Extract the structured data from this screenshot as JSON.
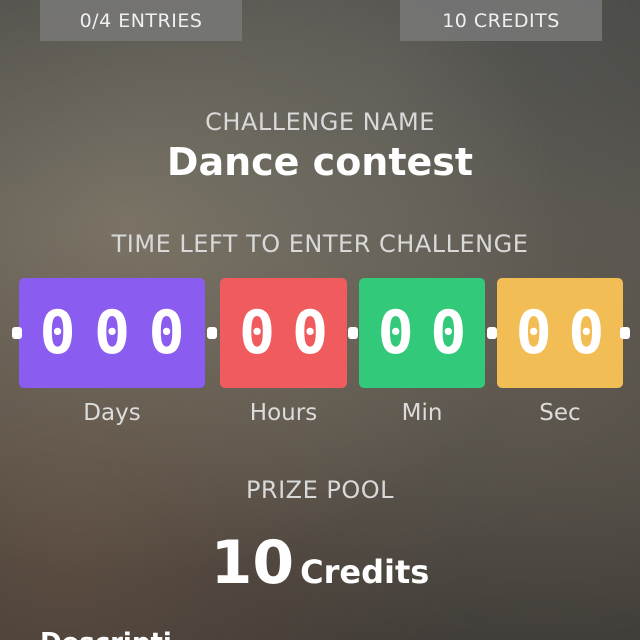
{
  "header": {
    "entries_label": "0/4 ENTRIES",
    "credits_label": "10 CREDITS"
  },
  "challenge": {
    "label": "CHALLENGE NAME",
    "name": "Dance contest"
  },
  "timer": {
    "label": "TIME LEFT TO ENTER CHALLENGE",
    "units": [
      {
        "label": "Days",
        "digits": [
          "0",
          "0",
          "0"
        ],
        "color": "#8a5cf0"
      },
      {
        "label": "Hours",
        "digits": [
          "0",
          "0"
        ],
        "color": "#f05b5e"
      },
      {
        "label": "Min",
        "digits": [
          "0",
          "0"
        ],
        "color": "#33c97a"
      },
      {
        "label": "Sec",
        "digits": [
          "0",
          "0"
        ],
        "color": "#f2bd55"
      }
    ]
  },
  "prize": {
    "label": "PRIZE POOL",
    "amount": "10",
    "unit": "Credits"
  },
  "description": {
    "heading": "Descripti"
  }
}
